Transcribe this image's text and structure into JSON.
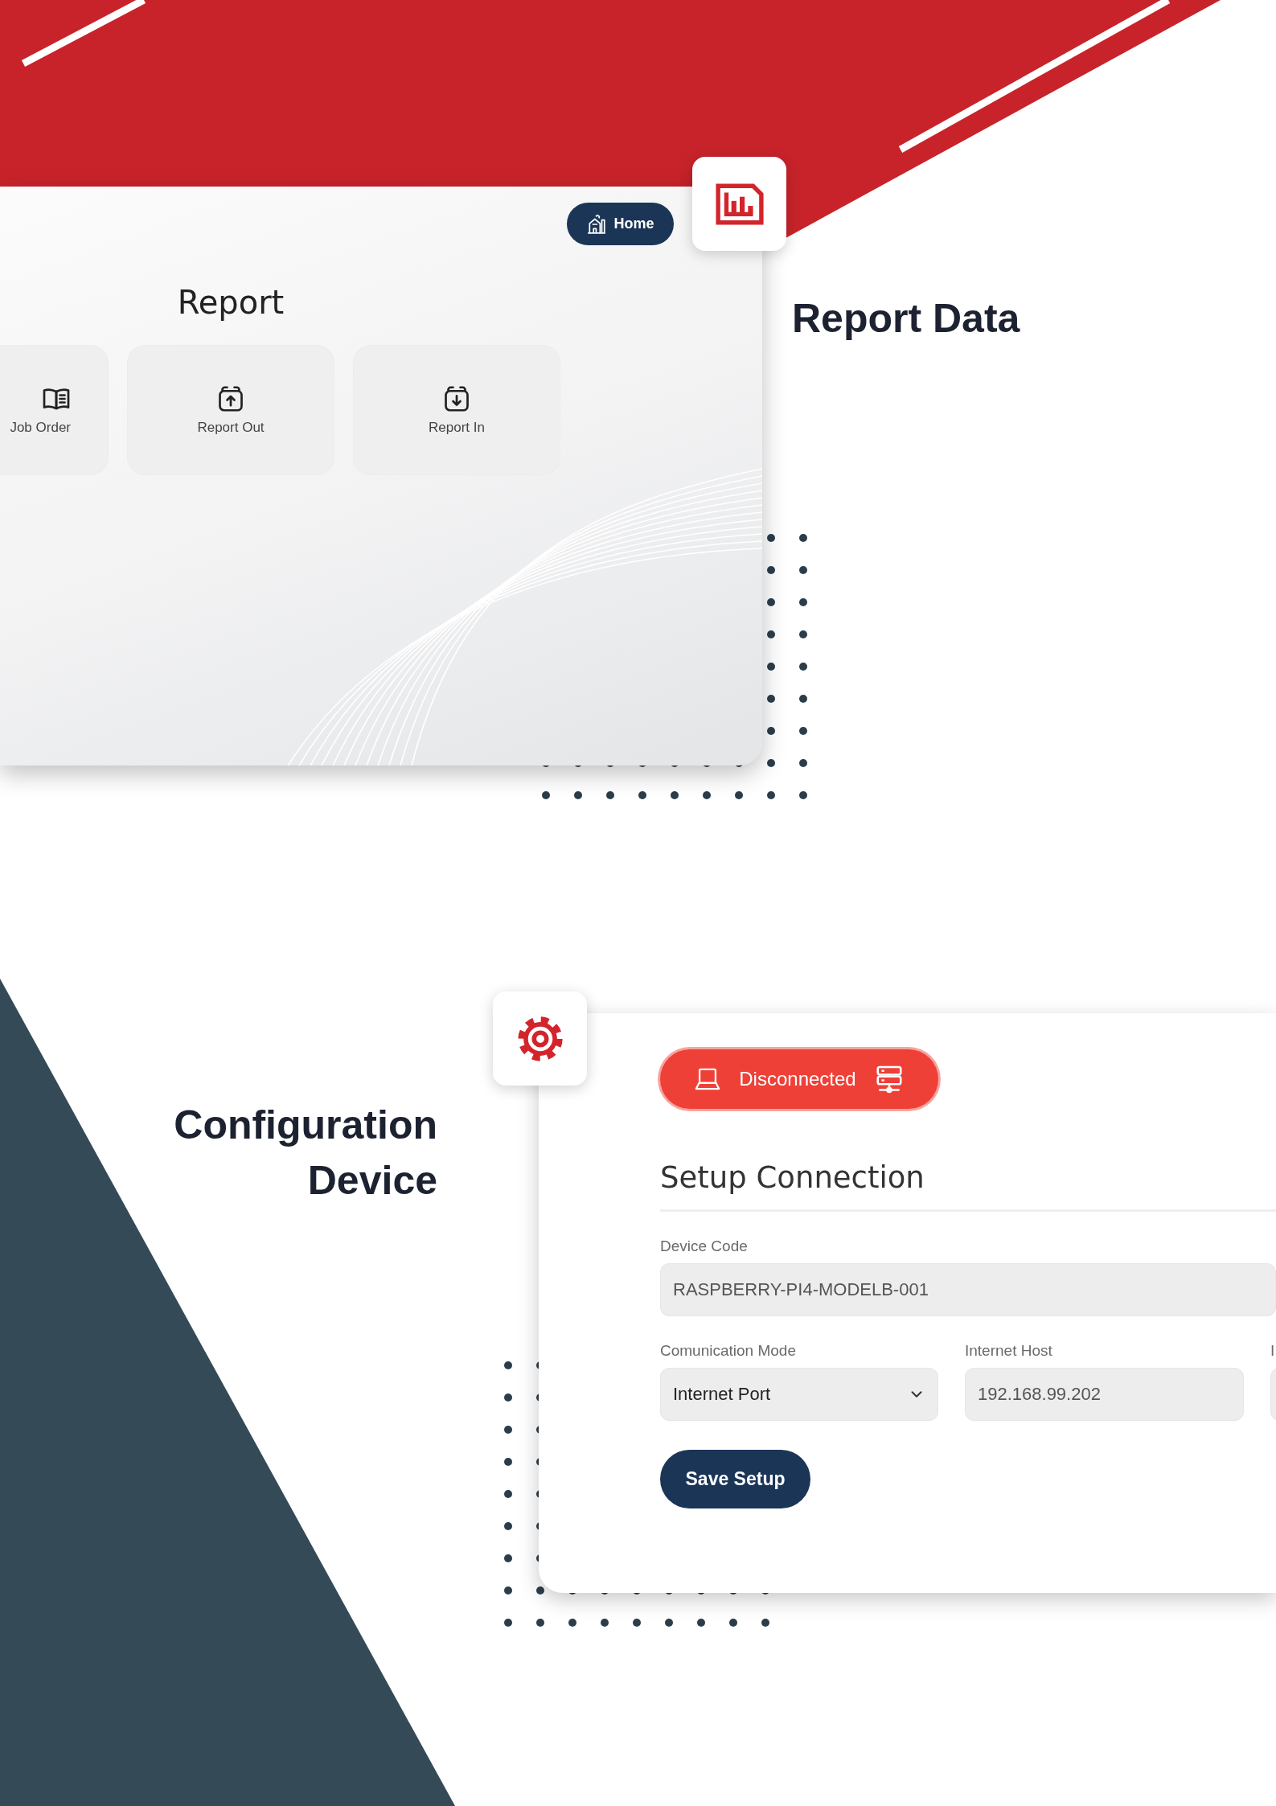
{
  "report_section": {
    "title": "Report Data",
    "screen": {
      "home_button": "Home",
      "heading": "Report",
      "tiles": [
        {
          "kind": "book",
          "label": "Job Order"
        },
        {
          "kind": "upload",
          "label": "Report Out"
        },
        {
          "kind": "download",
          "label": "Report In"
        }
      ]
    }
  },
  "config_section": {
    "title": "Configuration Device",
    "screen": {
      "status": {
        "label": "Disconnected",
        "connected": false
      },
      "heading": "Setup Connection",
      "rows": [
        [
          {
            "kind": "text",
            "label": "Device Code",
            "value": "RASPBERRY-PI4-MODELB-001"
          }
        ],
        [
          {
            "kind": "select",
            "label": "Comunication Mode",
            "value": "Internet Port"
          },
          {
            "kind": "text",
            "label": "Internet Host",
            "value": "192.168.99.202"
          },
          {
            "kind": "text",
            "label": "I"
          }
        ]
      ],
      "save_button": "Save Setup"
    }
  }
}
